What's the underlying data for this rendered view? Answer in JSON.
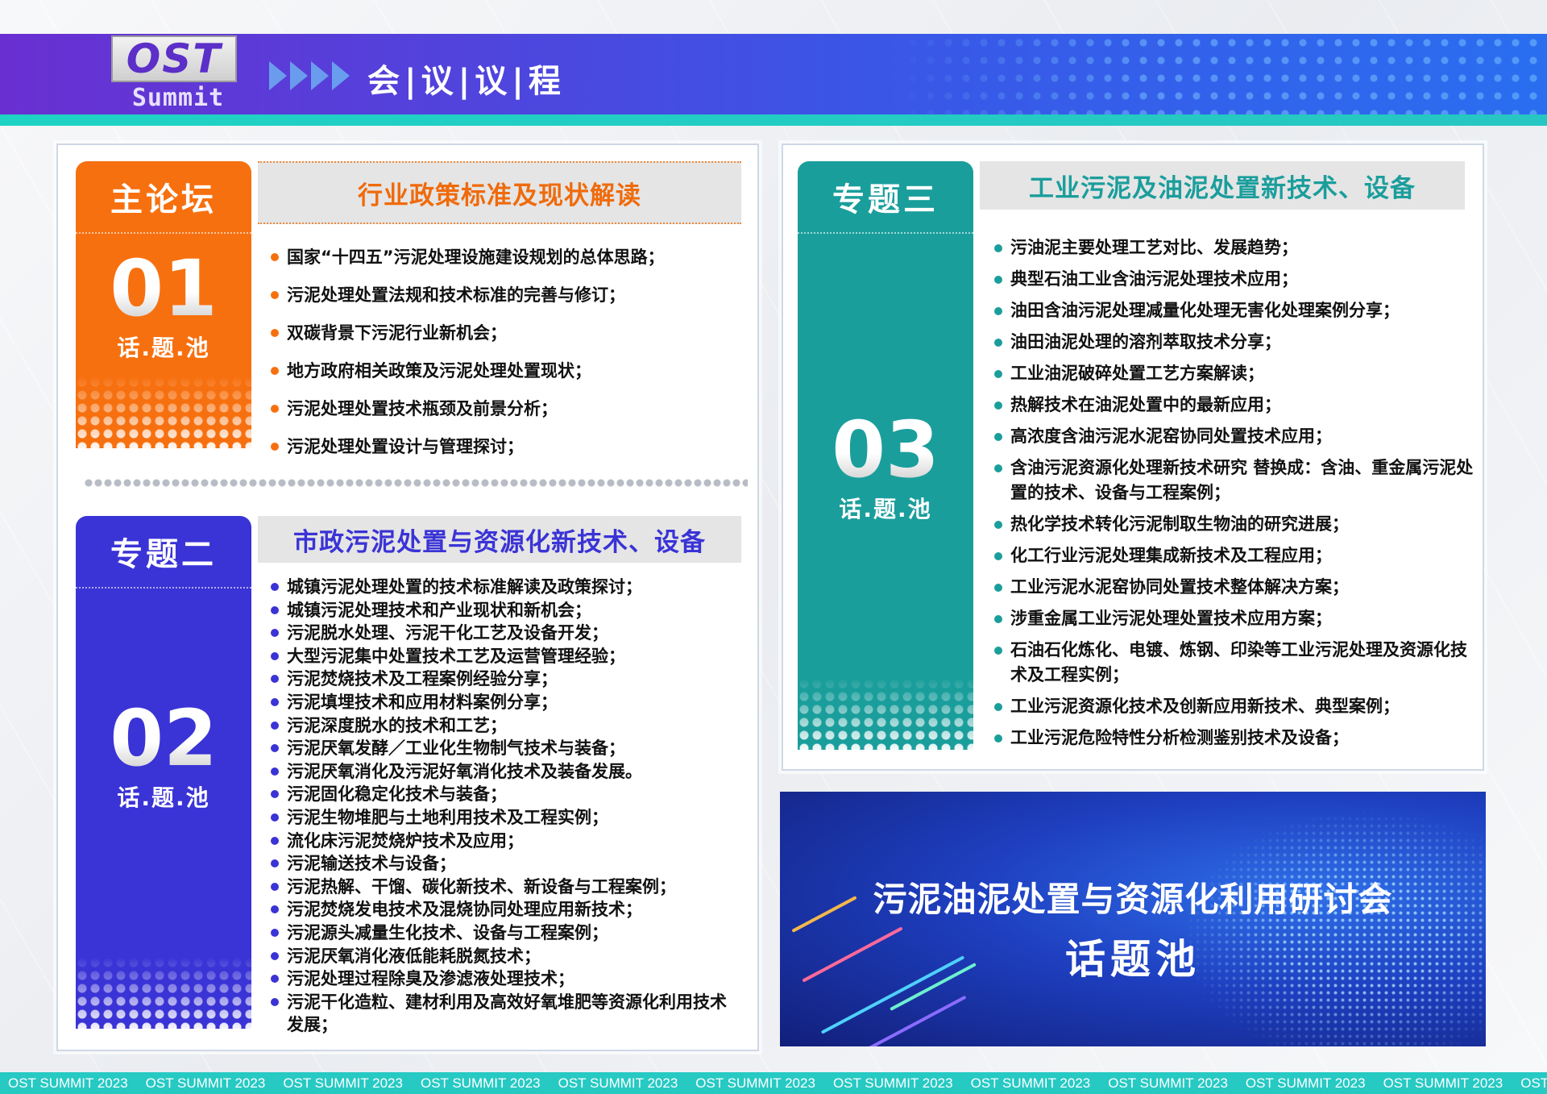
{
  "header": {
    "logo_text": "OST",
    "logo_sub": "Summit",
    "title": "会|议|议|程"
  },
  "forum_main": {
    "tag_title": "主论坛",
    "number": "01",
    "pool_label": "话.题.池",
    "section_title": "行业政策标准及现状解读",
    "items": [
      "国家“十四五”污泥处理设施建设规划的总体思路；",
      "污泥处理处置法规和技术标准的完善与修订；",
      "双碳背景下污泥行业新机会；",
      "地方政府相关政策及污泥处理处置现状；",
      "污泥处理处置技术瓶颈及前景分析；",
      "污泥处理处置设计与管理探讨；"
    ]
  },
  "topic_two": {
    "tag_title": "专题二",
    "number": "02",
    "pool_label": "话.题.池",
    "section_title": "市政污泥处置与资源化新技术、设备",
    "items": [
      "城镇污泥处理处置的技术标准解读及政策探讨；",
      "城镇污泥处理技术和产业现状和新机会；",
      "污泥脱水处理、污泥干化工艺及设备开发；",
      "大型污泥集中处置技术工艺及运营管理经验；",
      "污泥焚烧技术及工程案例经验分享；",
      "污泥填埋技术和应用材料案例分享；",
      "污泥深度脱水的技术和工艺；",
      "污泥厌氧发酵／工业化生物制气技术与装备；",
      "污泥厌氧消化及污泥好氧消化技术及装备发展。",
      "污泥固化稳定化技术与装备；",
      "污泥生物堆肥与土地利用技术及工程实例；",
      "流化床污泥焚烧炉技术及应用；",
      "污泥输送技术与设备；",
      "污泥热解、干馏、碳化新技术、新设备与工程案例；",
      "污泥焚烧发电技术及混烧协同处理应用新技术；",
      "污泥源头减量生化技术、设备与工程案例；",
      "污泥厌氧消化液低能耗脱氮技术；",
      "污泥处理过程除臭及渗滤液处理技术；",
      "污泥干化造粒、建材利用及高效好氧堆肥等资源化利用技术发展；"
    ]
  },
  "topic_three": {
    "tag_title": "专题三",
    "number": "03",
    "pool_label": "话.题.池",
    "section_title": "工业污泥及油泥处置新技术、设备",
    "items": [
      "污油泥主要处理工艺对比、发展趋势；",
      "典型石油工业含油污泥处理技术应用；",
      "油田含油污泥处理减量化处理无害化处理案例分享；",
      "油田油泥处理的溶剂萃取技术分享；",
      "工业油泥破碎处置工艺方案解读；",
      "热解技术在油泥处置中的最新应用；",
      "高浓度含油污泥水泥窑协同处置技术应用；",
      "含油污泥资源化处理新技术研究 替换成：含油、重金属污泥处置的技术、设备与工程案例；",
      "热化学技术转化污泥制取生物油的研究进展；",
      "化工行业污泥处理集成新技术及工程应用；",
      "工业污泥水泥窑协同处置技术整体解决方案；",
      "涉重金属工业污泥处理处置技术应用方案；",
      "石油石化炼化、电镀、炼钢、印染等工业污泥处理及资源化技术及工程实例；",
      "工业污泥资源化技术及创新应用新技术、典型案例；",
      "工业污泥危险特性分析检测鉴别技术及设备；"
    ]
  },
  "banner": {
    "title": "污泥油泥处置与资源化利用研讨会",
    "subtitle": "话题池"
  },
  "footer": {
    "items": [
      "OST SUMMIT 2023",
      "OST SUMMIT 2023",
      "OST SUMMIT 2023",
      "OST SUMMIT 2023",
      "OST SUMMIT 2023",
      "OST SUMMIT 2023",
      "OST SUMMIT 2023",
      "OST SUMMIT 2023",
      "OST SUMMIT 2023",
      "OST SUMMIT 2023",
      "OST SUMMIT 2023",
      "OST SUMMIT 2023"
    ]
  },
  "colors": {
    "orange": "#f7700f",
    "blue": "#3a33d6",
    "teal": "#1a9e9c",
    "header_purple": "#6a2fd1",
    "strip_cyan": "#27c9c3"
  }
}
